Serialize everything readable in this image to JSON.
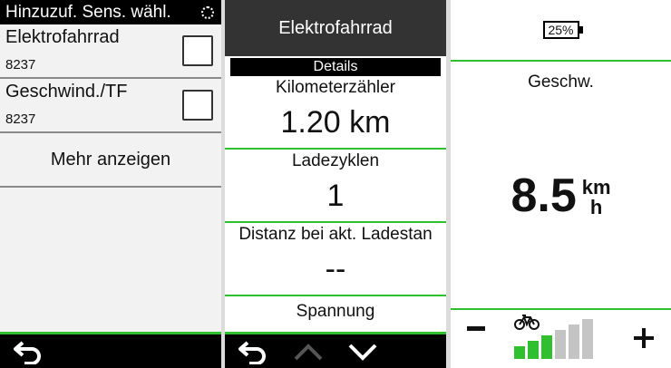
{
  "colors": {
    "accent": "#2fbf2f",
    "header_dark": "#000000",
    "header_gray": "#333333",
    "bar_inactive": "#c4c4c4"
  },
  "sensors_screen": {
    "title": "Hinzuzuf. Sens. wähl.",
    "sensors": [
      {
        "name": "Elektrofahrrad",
        "id": "8237",
        "checked": false
      },
      {
        "name": "Geschwind./TF",
        "id": "8237",
        "checked": false
      }
    ],
    "more_label": "Mehr anzeigen",
    "icons": {
      "loading": "spinner-icon",
      "back": "back-arrow-icon"
    }
  },
  "details_screen": {
    "title": "Elektrofahrrad",
    "section": "Details",
    "fields": [
      {
        "label": "Kilometerzähler",
        "value": "1.20 km"
      },
      {
        "label": "Ladezyklen",
        "value": "1"
      },
      {
        "label": "Distanz bei akt. Ladestan",
        "value": "--"
      }
    ],
    "last_label": "Spannung",
    "icons": {
      "back": "back-arrow-icon",
      "up": "chevron-up-icon",
      "down": "chevron-down-icon"
    }
  },
  "speed_screen": {
    "battery": "25%",
    "speed_label": "Geschw.",
    "speed_value": "8.5",
    "unit_top": "km",
    "unit_bottom": "h",
    "assist": {
      "level": 3,
      "max": 6
    },
    "icons": {
      "battery": "battery-icon",
      "bike": "ebike-icon",
      "decrease": "minus-icon",
      "increase": "plus-icon"
    }
  }
}
